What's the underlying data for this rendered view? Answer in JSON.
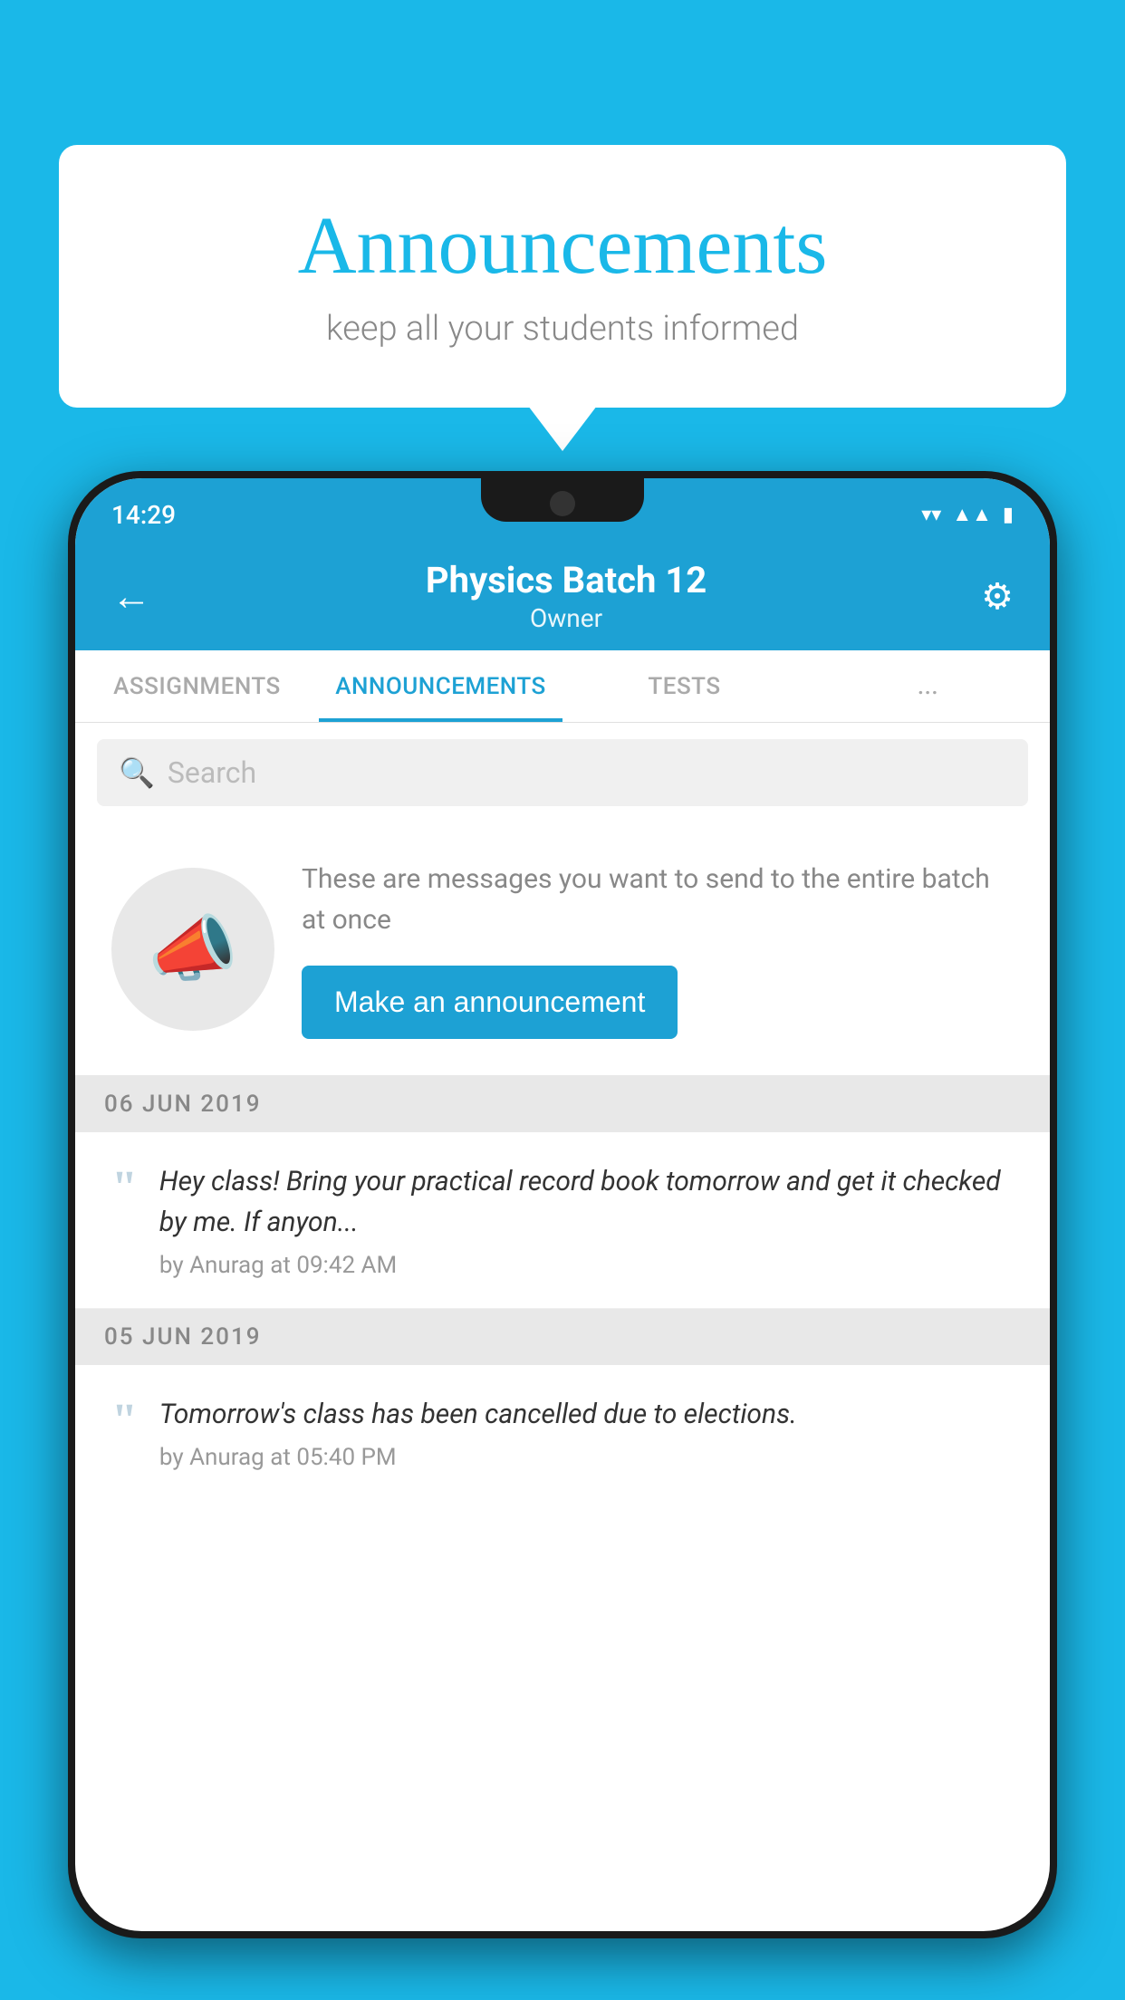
{
  "background_color": "#1ab8e8",
  "speech_bubble": {
    "title": "Announcements",
    "subtitle": "keep all your students informed"
  },
  "status_bar": {
    "time": "14:29",
    "wifi_icon": "wifi",
    "signal_icon": "signal",
    "battery_icon": "battery"
  },
  "header": {
    "title": "Physics Batch 12",
    "subtitle": "Owner",
    "back_label": "←",
    "settings_label": "⚙"
  },
  "tabs": [
    {
      "label": "ASSIGNMENTS",
      "active": false
    },
    {
      "label": "ANNOUNCEMENTS",
      "active": true
    },
    {
      "label": "TESTS",
      "active": false
    },
    {
      "label": "...",
      "active": false
    }
  ],
  "search": {
    "placeholder": "Search"
  },
  "promo": {
    "description": "These are messages you want to send to the entire batch at once",
    "button_label": "Make an announcement"
  },
  "announcements": [
    {
      "date": "06  JUN  2019",
      "text": "Hey class! Bring your practical record book tomorrow and get it checked by me. If anyon...",
      "author": "by Anurag at 09:42 AM"
    },
    {
      "date": "05  JUN  2019",
      "text": "Tomorrow's class has been cancelled due to elections.",
      "author": "by Anurag at 05:40 PM"
    }
  ]
}
